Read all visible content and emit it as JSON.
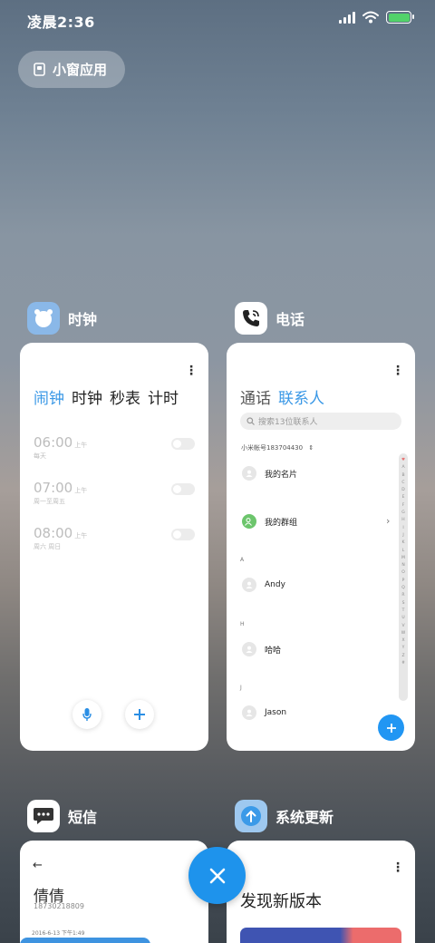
{
  "status_bar": {
    "time": "凌晨2:36"
  },
  "floating_window": {
    "label": "小窗应用"
  },
  "cards": {
    "clock": {
      "app_name": "时钟",
      "tabs": [
        "闹钟",
        "时钟",
        "秒表",
        "计时"
      ],
      "alarms": [
        {
          "time": "06:00",
          "ampm": "上午",
          "repeat": "每天"
        },
        {
          "time": "07:00",
          "ampm": "上午",
          "repeat": "周一至周五"
        },
        {
          "time": "08:00",
          "ampm": "上午",
          "repeat": "周六 周日"
        }
      ]
    },
    "phone": {
      "app_name": "电话",
      "tabs": [
        "通话",
        "联系人"
      ],
      "search_placeholder": "搜索13位联系人",
      "account": "小米帐号183704430",
      "my_card": "我的名片",
      "my_groups": "我的群组",
      "sections": [
        "A",
        "H",
        "J"
      ],
      "contacts": [
        "Andy",
        "哈哈",
        "Jason"
      ],
      "index_letters": [
        "♥",
        "A",
        "B",
        "C",
        "D",
        "E",
        "F",
        "G",
        "H",
        "I",
        "J",
        "K",
        "L",
        "M",
        "N",
        "O",
        "P",
        "Q",
        "R",
        "S",
        "T",
        "U",
        "V",
        "W",
        "X",
        "Y",
        "Z",
        "#"
      ]
    },
    "sms": {
      "app_name": "短信",
      "contact_name": "倩倩",
      "phone_number": "18730218809",
      "date": "2016-6-13 下午1:49"
    },
    "update": {
      "app_name": "系统更新",
      "title": "发现新版本"
    }
  },
  "colors": {
    "accent": "#3a98e6",
    "fab": "#2196f3",
    "close_button": "#1e93ec",
    "battery": "#52d26a"
  }
}
